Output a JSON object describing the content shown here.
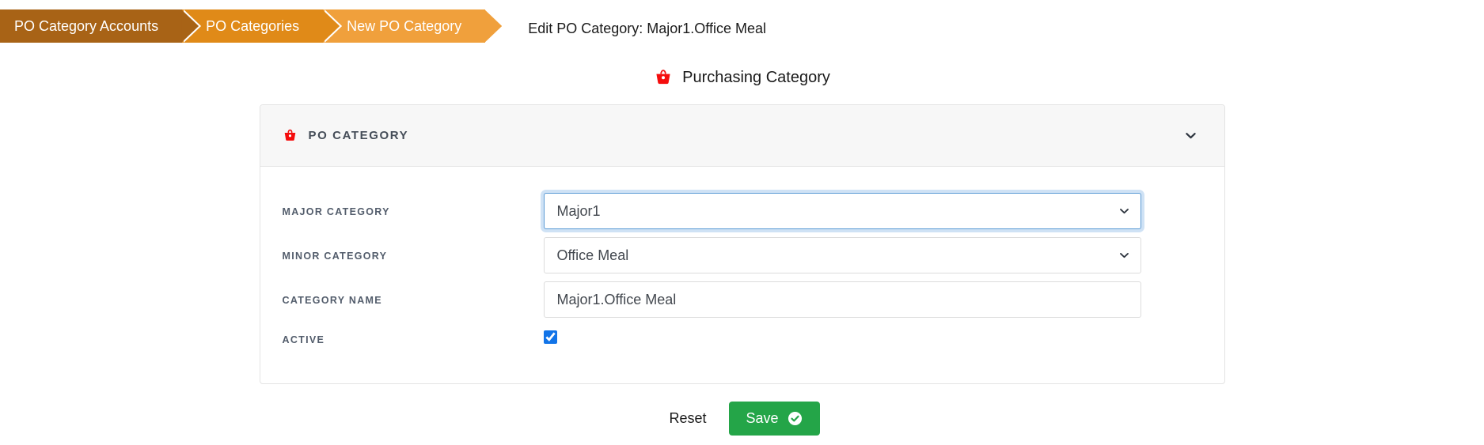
{
  "breadcrumb": {
    "items": [
      {
        "label": "PO Category Accounts",
        "color": "#a86316"
      },
      {
        "label": "PO Categories",
        "color": "#e08a18"
      },
      {
        "label": "New PO Category",
        "color": "#f0a03c"
      }
    ]
  },
  "header": {
    "page_title": "Edit PO Category: Major1.Office Meal",
    "section_title": "Purchasing Category",
    "section_icon": "shopping-basket-icon"
  },
  "card": {
    "title": "PO CATEGORY",
    "icon": "shopping-basket-icon",
    "collapse_icon": "chevron-down-icon",
    "fields": [
      {
        "label": "MAJOR CATEGORY",
        "type": "select",
        "value": "Major1",
        "options": [
          "Major1"
        ],
        "focused": true,
        "icon": "chevron-down-icon"
      },
      {
        "label": "MINOR CATEGORY",
        "type": "select",
        "value": "Office Meal",
        "options": [
          "Office Meal"
        ],
        "focused": false,
        "icon": "chevron-down-icon"
      },
      {
        "label": "CATEGORY NAME",
        "type": "text",
        "value": "Major1.Office Meal",
        "placeholder": ""
      },
      {
        "label": "ACTIVE",
        "type": "checkbox",
        "checked": true
      }
    ]
  },
  "actions": {
    "reset_label": "Reset",
    "save_label": "Save",
    "save_icon": "check-circle-icon",
    "save_color": "#24a548"
  }
}
